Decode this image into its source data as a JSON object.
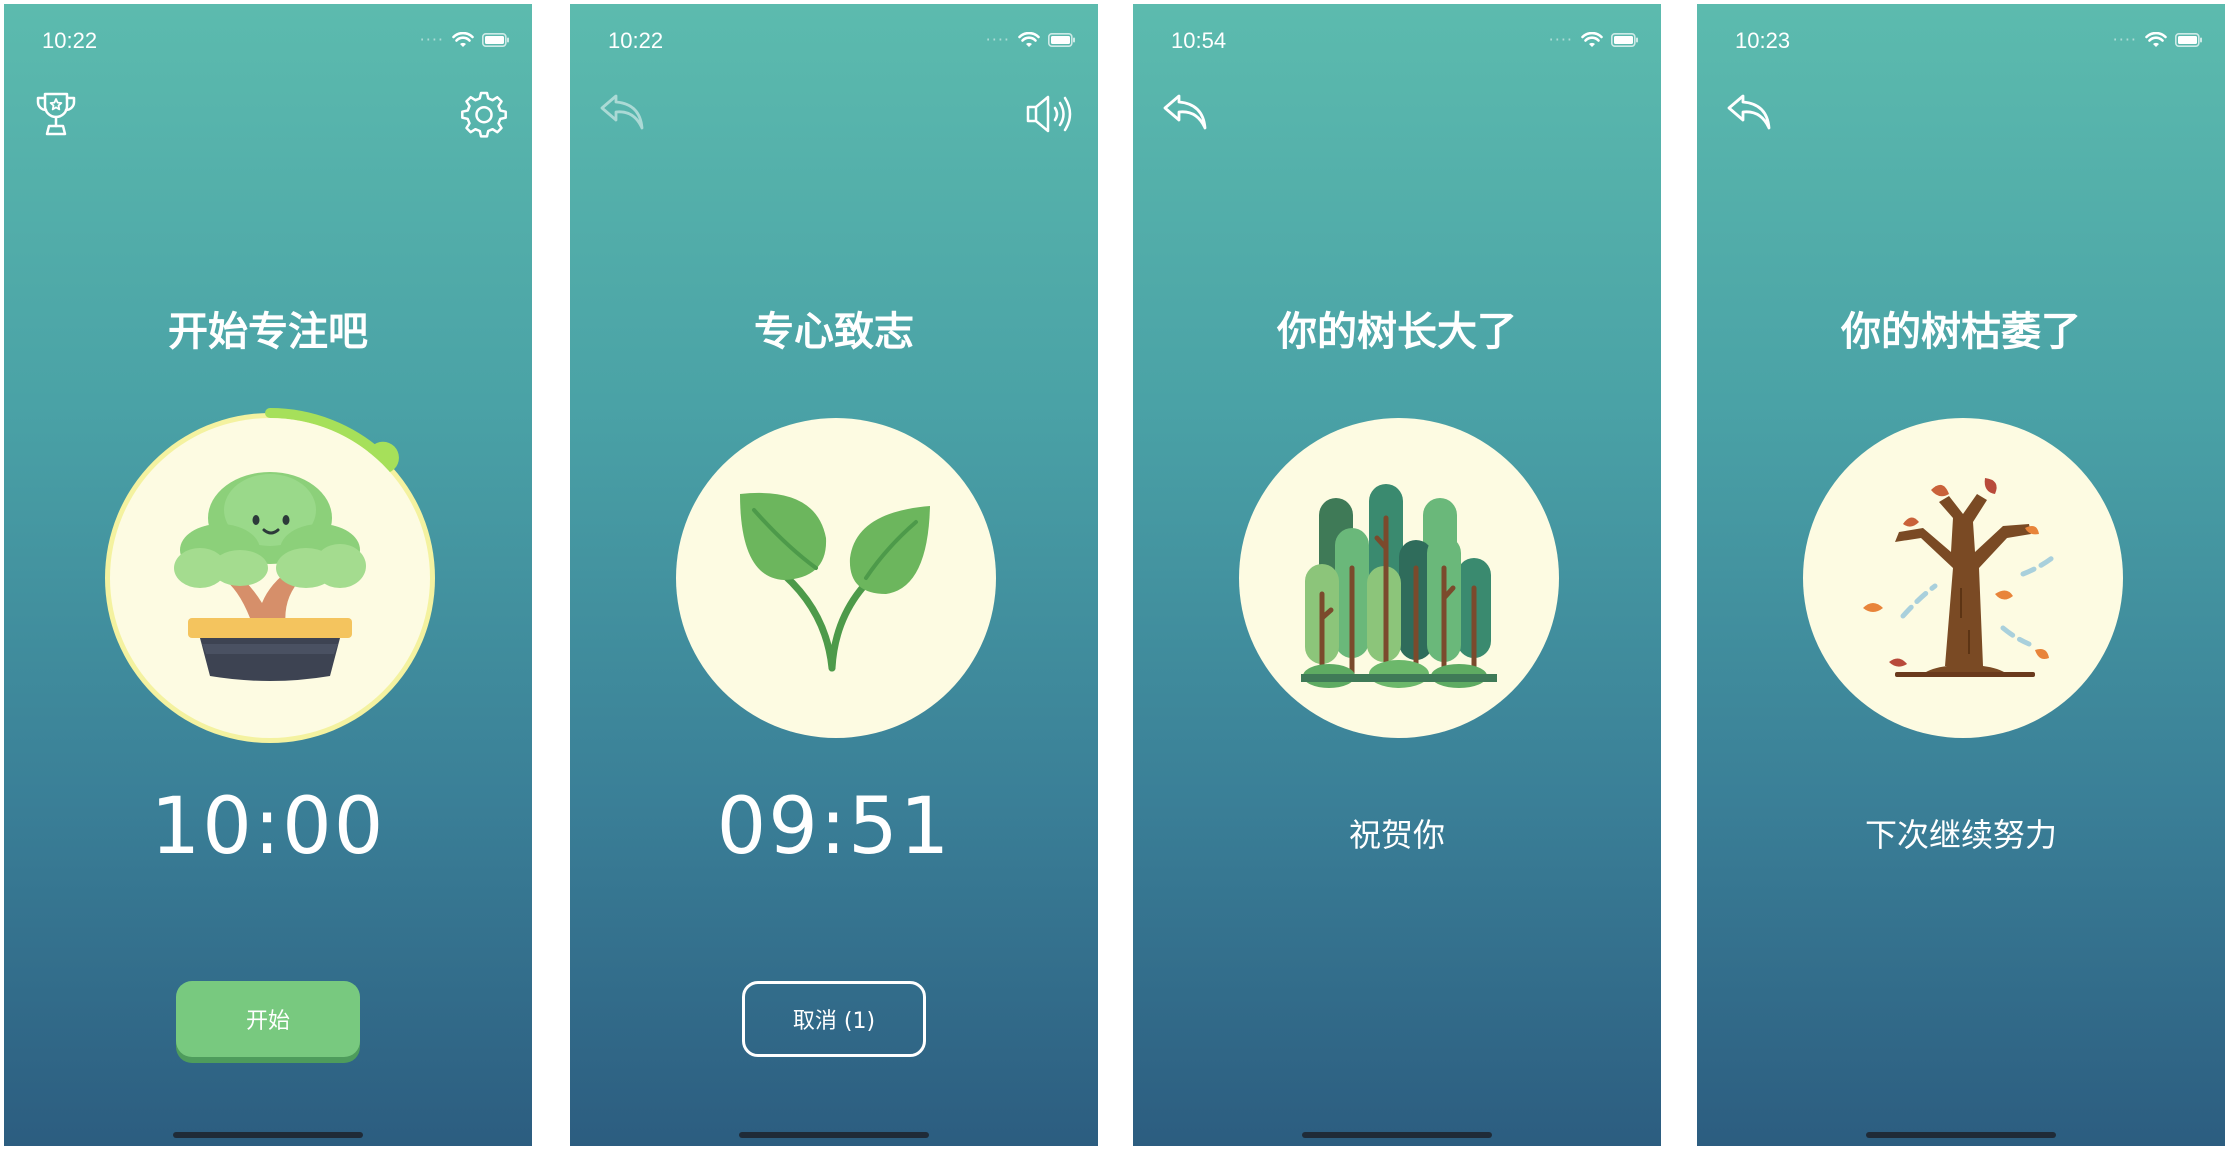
{
  "screens": [
    {
      "status_time": "10:22",
      "title": "开始专注吧",
      "timer": "10:00",
      "button_label": "开始",
      "top_left_icon": "trophy-icon",
      "top_right_icon": "gear-icon",
      "progress": 0.12
    },
    {
      "status_time": "10:22",
      "title": "专心致志",
      "timer": "09:51",
      "button_label": "取消 (1)",
      "top_left_icon": "back-arrow-icon",
      "top_right_icon": "speaker-icon"
    },
    {
      "status_time": "10:54",
      "title": "你的树长大了",
      "subtitle": "祝贺你",
      "top_left_icon": "back-arrow-icon"
    },
    {
      "status_time": "10:23",
      "title": "你的树枯萎了",
      "subtitle": "下次继续努力",
      "top_left_icon": "back-arrow-icon"
    }
  ],
  "colors": {
    "accent_green": "#78c97f",
    "circle_bg": "#fdfbe2",
    "progress_ring": "#f4f2a0",
    "progress_active": "#a6e05a"
  }
}
